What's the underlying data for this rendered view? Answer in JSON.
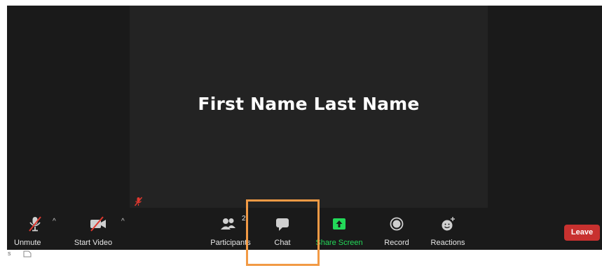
{
  "meeting": {
    "participant_name": "First Name Last Name"
  },
  "toolbar": {
    "unmute_label": "Unmute",
    "start_video_label": "Start Video",
    "participants_label": "Participants",
    "participants_count": "2",
    "chat_label": "Chat",
    "share_screen_label": "Share Screen",
    "record_label": "Record",
    "reactions_label": "Reactions",
    "leave_label": "Leave",
    "caret": "^"
  },
  "colors": {
    "background": "#1a1a1a",
    "tile": "#232323",
    "share_green": "#23d959",
    "leave_red": "#c8312f",
    "mute_red": "#e0382f",
    "highlight_orange": "#f29a45"
  },
  "icons": {
    "mute": "microphone-muted-icon",
    "video": "video-off-icon",
    "participants": "people-icon",
    "chat": "chat-bubble-icon",
    "share": "share-screen-arrow-icon",
    "record": "record-circle-icon",
    "reactions": "smiley-plus-icon"
  },
  "below": {
    "fragment": "s"
  }
}
